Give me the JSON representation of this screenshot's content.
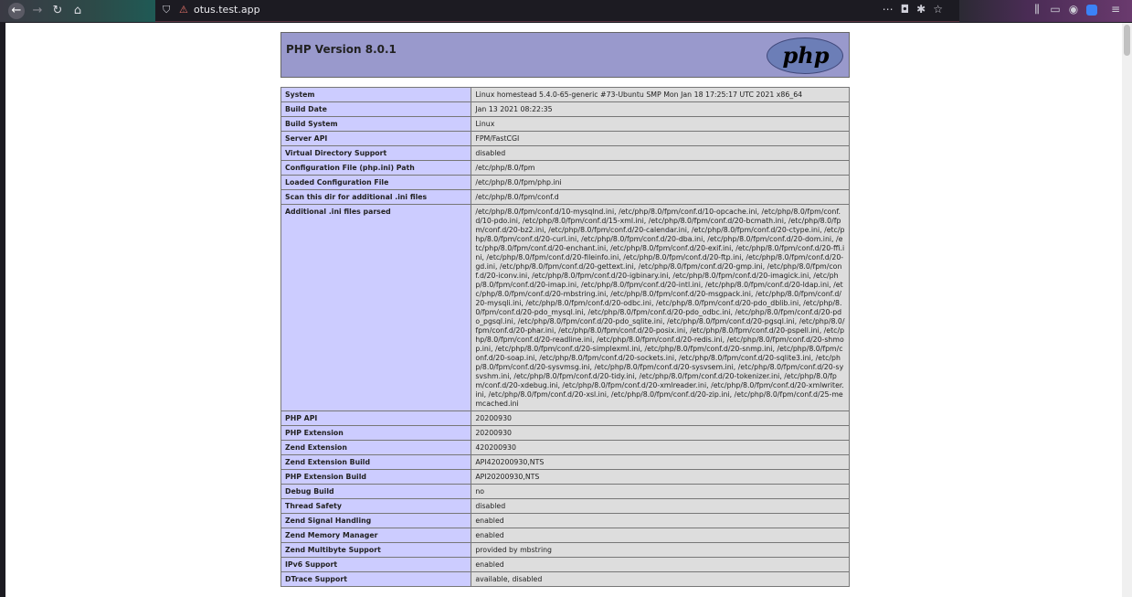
{
  "browser": {
    "url": "otus.test.app",
    "icons": {
      "back": "arrow-left-icon",
      "forward": "arrow-right-icon",
      "reload": "reload-icon",
      "home": "home-icon",
      "tracking": "shield-icon",
      "permissions": "site-permission-icon",
      "more": "more-dots-icon",
      "pocket": "pocket-icon",
      "extension": "bug-icon",
      "bookmark": "star-icon",
      "library": "library-icon",
      "sidebar": "sidebar-icon",
      "account": "account-icon",
      "menu": "hamburger-menu-icon"
    }
  },
  "php": {
    "version_title": "PHP Version 8.0.1",
    "logo_text": "php",
    "rows": [
      {
        "key": "System",
        "value": "Linux homestead 5.4.0-65-generic #73-Ubuntu SMP Mon Jan 18 17:25:17 UTC 2021 x86_64"
      },
      {
        "key": "Build Date",
        "value": "Jan 13 2021 08:22:35"
      },
      {
        "key": "Build System",
        "value": "Linux"
      },
      {
        "key": "Server API",
        "value": "FPM/FastCGI"
      },
      {
        "key": "Virtual Directory Support",
        "value": "disabled"
      },
      {
        "key": "Configuration File (php.ini) Path",
        "value": "/etc/php/8.0/fpm"
      },
      {
        "key": "Loaded Configuration File",
        "value": "/etc/php/8.0/fpm/php.ini"
      },
      {
        "key": "Scan this dir for additional .ini files",
        "value": "/etc/php/8.0/fpm/conf.d"
      },
      {
        "key": "Additional .ini files parsed",
        "value": "/etc/php/8.0/fpm/conf.d/10-mysqlnd.ini, /etc/php/8.0/fpm/conf.d/10-opcache.ini, /etc/php/8.0/fpm/conf.d/10-pdo.ini, /etc/php/8.0/fpm/conf.d/15-xml.ini, /etc/php/8.0/fpm/conf.d/20-bcmath.ini, /etc/php/8.0/fpm/conf.d/20-bz2.ini, /etc/php/8.0/fpm/conf.d/20-calendar.ini, /etc/php/8.0/fpm/conf.d/20-ctype.ini, /etc/php/8.0/fpm/conf.d/20-curl.ini, /etc/php/8.0/fpm/conf.d/20-dba.ini, /etc/php/8.0/fpm/conf.d/20-dom.ini, /etc/php/8.0/fpm/conf.d/20-enchant.ini, /etc/php/8.0/fpm/conf.d/20-exif.ini, /etc/php/8.0/fpm/conf.d/20-ffi.ini, /etc/php/8.0/fpm/conf.d/20-fileinfo.ini, /etc/php/8.0/fpm/conf.d/20-ftp.ini, /etc/php/8.0/fpm/conf.d/20-gd.ini, /etc/php/8.0/fpm/conf.d/20-gettext.ini, /etc/php/8.0/fpm/conf.d/20-gmp.ini, /etc/php/8.0/fpm/conf.d/20-iconv.ini, /etc/php/8.0/fpm/conf.d/20-igbinary.ini, /etc/php/8.0/fpm/conf.d/20-imagick.ini, /etc/php/8.0/fpm/conf.d/20-imap.ini, /etc/php/8.0/fpm/conf.d/20-intl.ini, /etc/php/8.0/fpm/conf.d/20-ldap.ini, /etc/php/8.0/fpm/conf.d/20-mbstring.ini, /etc/php/8.0/fpm/conf.d/20-msgpack.ini, /etc/php/8.0/fpm/conf.d/20-mysqli.ini, /etc/php/8.0/fpm/conf.d/20-odbc.ini, /etc/php/8.0/fpm/conf.d/20-pdo_dblib.ini, /etc/php/8.0/fpm/conf.d/20-pdo_mysql.ini, /etc/php/8.0/fpm/conf.d/20-pdo_odbc.ini, /etc/php/8.0/fpm/conf.d/20-pdo_pgsql.ini, /etc/php/8.0/fpm/conf.d/20-pdo_sqlite.ini, /etc/php/8.0/fpm/conf.d/20-pgsql.ini, /etc/php/8.0/fpm/conf.d/20-phar.ini, /etc/php/8.0/fpm/conf.d/20-posix.ini, /etc/php/8.0/fpm/conf.d/20-pspell.ini, /etc/php/8.0/fpm/conf.d/20-readline.ini, /etc/php/8.0/fpm/conf.d/20-redis.ini, /etc/php/8.0/fpm/conf.d/20-shmop.ini, /etc/php/8.0/fpm/conf.d/20-simplexml.ini, /etc/php/8.0/fpm/conf.d/20-snmp.ini, /etc/php/8.0/fpm/conf.d/20-soap.ini, /etc/php/8.0/fpm/conf.d/20-sockets.ini, /etc/php/8.0/fpm/conf.d/20-sqlite3.ini, /etc/php/8.0/fpm/conf.d/20-sysvmsg.ini, /etc/php/8.0/fpm/conf.d/20-sysvsem.ini, /etc/php/8.0/fpm/conf.d/20-sysvshm.ini, /etc/php/8.0/fpm/conf.d/20-tidy.ini, /etc/php/8.0/fpm/conf.d/20-tokenizer.ini, /etc/php/8.0/fpm/conf.d/20-xdebug.ini, /etc/php/8.0/fpm/conf.d/20-xmlreader.ini, /etc/php/8.0/fpm/conf.d/20-xmlwriter.ini, /etc/php/8.0/fpm/conf.d/20-xsl.ini, /etc/php/8.0/fpm/conf.d/20-zip.ini, /etc/php/8.0/fpm/conf.d/25-memcached.ini"
      },
      {
        "key": "PHP API",
        "value": "20200930"
      },
      {
        "key": "PHP Extension",
        "value": "20200930"
      },
      {
        "key": "Zend Extension",
        "value": "420200930"
      },
      {
        "key": "Zend Extension Build",
        "value": "API420200930,NTS"
      },
      {
        "key": "PHP Extension Build",
        "value": "API20200930,NTS"
      },
      {
        "key": "Debug Build",
        "value": "no"
      },
      {
        "key": "Thread Safety",
        "value": "disabled"
      },
      {
        "key": "Zend Signal Handling",
        "value": "enabled"
      },
      {
        "key": "Zend Memory Manager",
        "value": "enabled"
      },
      {
        "key": "Zend Multibyte Support",
        "value": "provided by mbstring"
      },
      {
        "key": "IPv6 Support",
        "value": "enabled"
      },
      {
        "key": "DTrace Support",
        "value": "available, disabled"
      }
    ]
  }
}
